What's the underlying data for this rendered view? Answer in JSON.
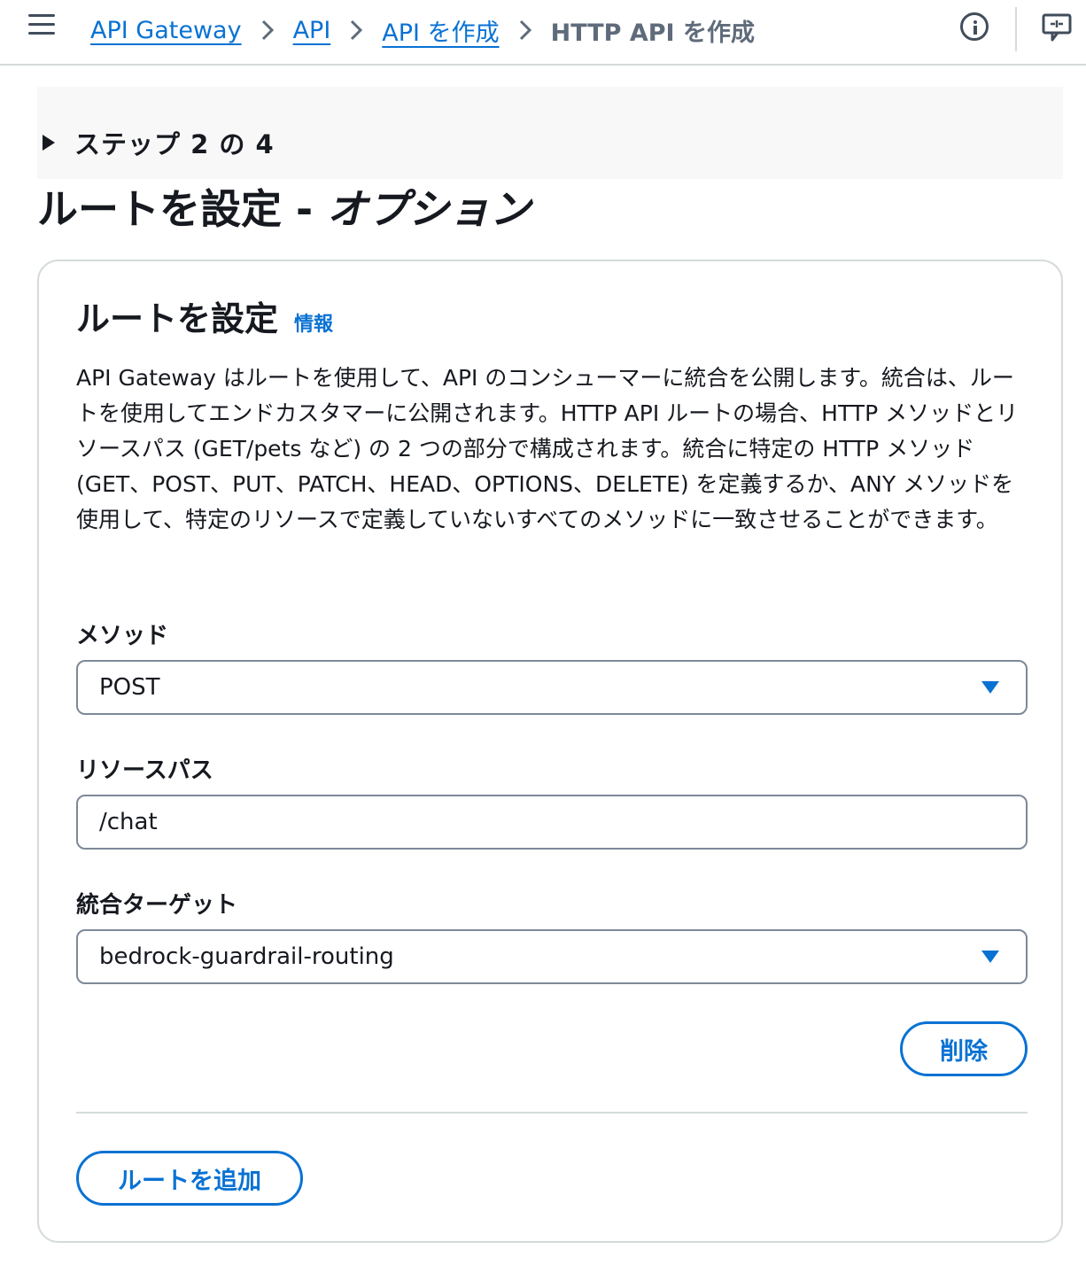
{
  "breadcrumb": {
    "items": [
      "API Gateway",
      "API",
      "API を作成"
    ],
    "current": "HTTP API を作成"
  },
  "icons": {
    "menu": "hamburger-menu-icon",
    "info": "info-circle-icon",
    "feedback": "feedback-icon"
  },
  "step": {
    "label": "ステップ 2 の 4"
  },
  "page": {
    "title_main": "ルートを設定 - ",
    "title_italic": "オプション"
  },
  "card": {
    "title": "ルートを設定",
    "info_link": "情報",
    "description": "API Gateway はルートを使用して、API のコンシューマーに統合を公開します。統合は、ルートを使用してエンドカスタマーに公開されます。HTTP API ルートの場合、HTTP メソッドとリソースパス (GET/pets など) の 2 つの部分で構成されます。統合に特定の HTTP メソッド (GET、POST、PUT、PATCH、HEAD、OPTIONS、DELETE) を定義するか、ANY メソッドを使用して、特定のリソースで定義していないすべてのメソッドに一致させることができます。"
  },
  "form": {
    "method_label": "メソッド",
    "method_value": "POST",
    "resource_label": "リソースパス",
    "resource_value": "/chat",
    "target_label": "統合ターゲット",
    "target_value": "bedrock-guardrail-routing"
  },
  "buttons": {
    "delete": "削除",
    "add_route": "ルートを追加"
  },
  "colors": {
    "link": "#0972d3",
    "text": "#16191f",
    "border": "#7d8998",
    "muted": "#5f6b7a"
  }
}
